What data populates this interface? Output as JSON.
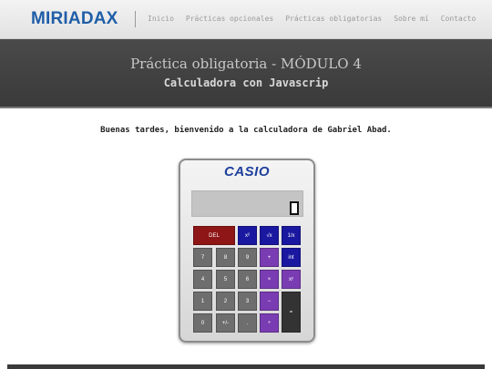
{
  "nav": {
    "logo": "MIRIADAX",
    "links": [
      "Inicio",
      "Prácticas opcionales",
      "Prácticas obligatorias",
      "Sobre mí",
      "Contacto"
    ]
  },
  "banner": {
    "title": "Práctica obligatoria - MÓDULO 4",
    "subtitle": "Calculadora con Javascrip"
  },
  "welcome": "Buenas tardes, bienvenido a la calculadora de Gabriel Abad.",
  "calculator": {
    "brand": "CASIO",
    "display": "",
    "keys": {
      "del": "DEL",
      "square": "x²",
      "sqrt": "√x",
      "inverse": "1/x",
      "k7": "7",
      "k8": "8",
      "k9": "9",
      "plus": "+",
      "int": "int",
      "k4": "4",
      "k5": "5",
      "k6": "6",
      "times": "×",
      "power": "xʸ",
      "k1": "1",
      "k2": "2",
      "k3": "3",
      "minus": "−",
      "equals": "=",
      "k0": "0",
      "sign": "+/-",
      "dot": ".",
      "divide": "÷"
    }
  },
  "colors": {
    "logo": "#1f5ea8",
    "key_red": "#8e1616",
    "key_blue": "#1a18a0",
    "key_purple": "#7a3cb2",
    "key_gray": "#6e6e6e",
    "key_dark": "#333333"
  }
}
